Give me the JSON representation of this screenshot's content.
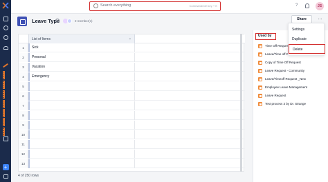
{
  "search": {
    "placeholder": "Search everything",
    "shortcut": "Command/Ctrl key + K"
  },
  "topbar": {
    "help": "?",
    "avatar": "JS"
  },
  "header": {
    "title": "Leave Type",
    "members": "2 member(s)",
    "share_label": "Share",
    "more_label": "..."
  },
  "table": {
    "column_header": "List of Items",
    "rows": [
      {
        "num": "1",
        "value": "Sick"
      },
      {
        "num": "2",
        "value": "Personal"
      },
      {
        "num": "3",
        "value": "Vacation"
      },
      {
        "num": "4",
        "value": "Emergency"
      },
      {
        "num": "5",
        "value": ""
      },
      {
        "num": "6",
        "value": ""
      },
      {
        "num": "7",
        "value": ""
      },
      {
        "num": "8",
        "value": ""
      },
      {
        "num": "9",
        "value": ""
      },
      {
        "num": "10",
        "value": ""
      },
      {
        "num": "11",
        "value": ""
      },
      {
        "num": "12",
        "value": ""
      },
      {
        "num": "13",
        "value": ""
      }
    ],
    "footer": "4 of 250 rows"
  },
  "used_by": {
    "title": "Used by",
    "items": [
      "Time Off Request",
      "Leave/Time off R",
      "Copy of Time Off Request",
      "Leave Request - Community",
      "Leave/Timeoff Request _New",
      "Employee Leave Management",
      "Leave Request",
      "Test process 3 by Dr. Strange"
    ]
  },
  "menu": {
    "items": [
      "Settings",
      "Duplicate",
      "Delete"
    ]
  }
}
